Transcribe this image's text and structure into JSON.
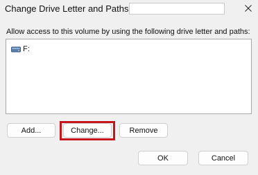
{
  "window": {
    "title": "Change Drive Letter and Paths for",
    "title_field_value": "",
    "close_icon": "close-icon"
  },
  "instruction": "Allow access to this volume by using the following drive letter and paths:",
  "list": {
    "items": [
      {
        "icon": "drive-icon",
        "label": "F:"
      }
    ]
  },
  "buttons": {
    "add": "Add...",
    "change": "Change...",
    "remove": "Remove",
    "ok": "OK",
    "cancel": "Cancel"
  },
  "colors": {
    "highlight": "#c4161c",
    "dialog_bg": "#f0f0f0"
  }
}
